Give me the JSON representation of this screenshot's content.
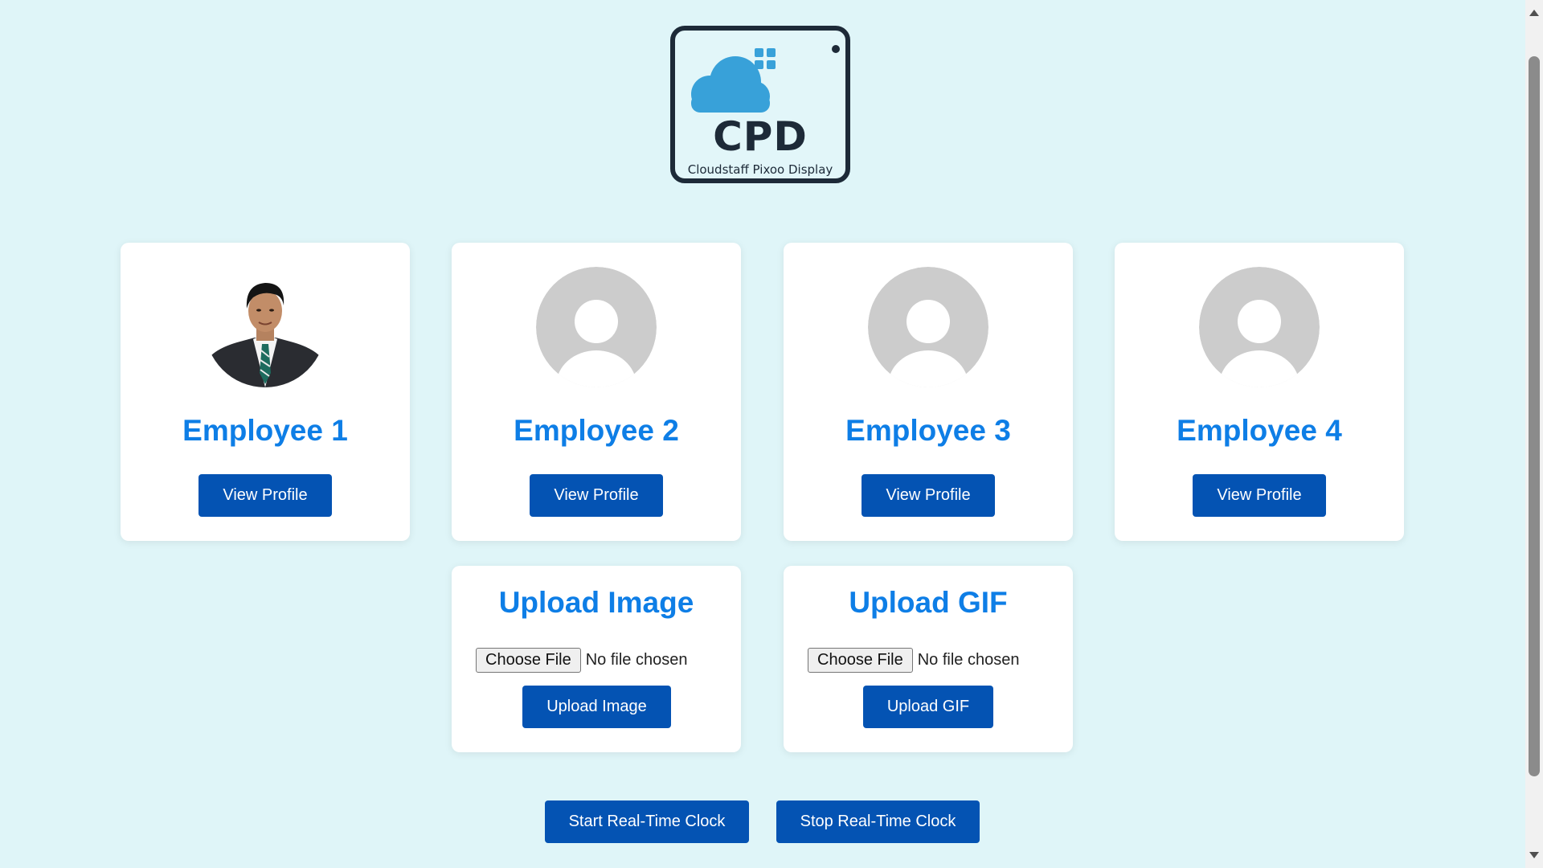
{
  "logo": {
    "title": "CPD",
    "subtitle": "Cloudstaff Pixoo Display",
    "icon": "cloud-grid-icon",
    "colors": {
      "border": "#1d2a38",
      "cloud": "#38a1d9"
    }
  },
  "employees": [
    {
      "name": "Employee 1",
      "button": "View Profile",
      "avatar": "employee-photo"
    },
    {
      "name": "Employee 2",
      "button": "View Profile",
      "avatar": "default-user-icon"
    },
    {
      "name": "Employee 3",
      "button": "View Profile",
      "avatar": "default-user-icon"
    },
    {
      "name": "Employee 4",
      "button": "View Profile",
      "avatar": "default-user-icon"
    }
  ],
  "upload_image": {
    "title": "Upload Image",
    "choose_label": "Choose File",
    "status": "No file chosen",
    "button": "Upload Image"
  },
  "upload_gif": {
    "title": "Upload GIF",
    "choose_label": "Choose File",
    "status": "No file chosen",
    "button": "Upload GIF"
  },
  "clock": {
    "start": "Start Real-Time Clock",
    "stop": "Stop Real-Time Clock"
  },
  "colors": {
    "background": "#dff5f8",
    "accent_text": "#0e7ee6",
    "button": "#0453b3",
    "avatar_placeholder": "#cccccc"
  }
}
